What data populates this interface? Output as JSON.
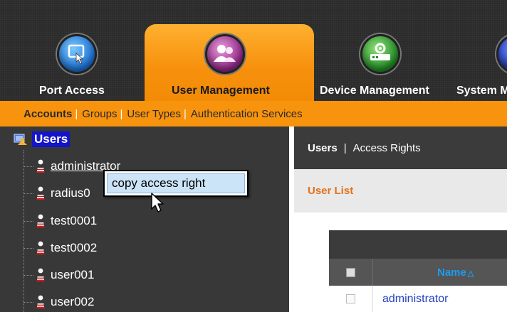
{
  "top_nav": {
    "tabs": [
      {
        "label": "Port Access",
        "icon": "port-access-icon"
      },
      {
        "label": "User Management",
        "icon": "user-management-icon",
        "active": true
      },
      {
        "label": "Device Management",
        "icon": "device-management-icon"
      },
      {
        "label": "System M",
        "icon": "system-icon"
      }
    ]
  },
  "sub_nav": {
    "items": [
      "Accounts",
      "Groups",
      "User Types",
      "Authentication Services"
    ],
    "separator": "|",
    "active": "Accounts"
  },
  "tree": {
    "root_label": "Users",
    "items": [
      "administrator",
      "radius0",
      "test0001",
      "test0002",
      "user001",
      "user002"
    ]
  },
  "context_menu": {
    "item": "copy access right"
  },
  "right_panel": {
    "header": {
      "item1": "Users",
      "separator": "|",
      "item2": "Access Rights"
    },
    "section_title": "User List",
    "table": {
      "columns": [
        "",
        "Name"
      ],
      "sort_indicator": "△",
      "rows": [
        {
          "name": "administrator"
        }
      ]
    }
  },
  "colors": {
    "accent": "#f7930c",
    "tree_bg": "#383838",
    "selected_root": "#1414c8",
    "link": "#1f3fbf",
    "section_title": "#e2721c"
  }
}
